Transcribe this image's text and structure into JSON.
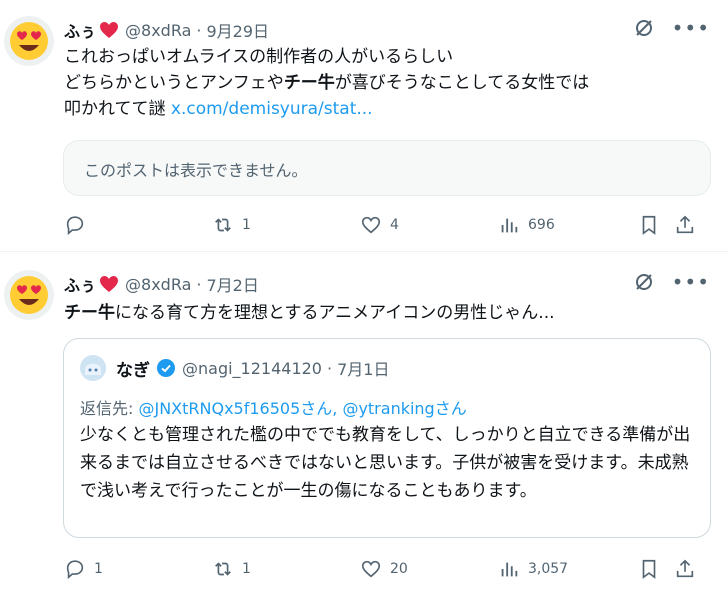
{
  "tweets": [
    {
      "name": "ふぅ",
      "handle": "@8xdRa",
      "separator": "·",
      "date": "9月29日",
      "lines": [
        {
          "text": "これおっぱいオムライスの制作者の人がいるらしい"
        },
        {
          "pre": "どちらかというとアンフェや",
          "bold": "チー牛",
          "post": "が喜びそうなことしてる女性では"
        },
        {
          "pre": "叩かれてて謎 ",
          "link": "x.com/demisyura/stat..."
        }
      ],
      "unavailable": "このポストは表示できません。",
      "actions": {
        "reply": "",
        "retweet": "1",
        "like": "4",
        "views": "696"
      }
    },
    {
      "name": "ふぅ",
      "handle": "@8xdRa",
      "separator": "·",
      "date": "7月2日",
      "line": {
        "bold": "チー牛",
        "post": "になる育て方を理想とするアニメアイコンの男性じゃん..."
      },
      "quote": {
        "name": "なぎ",
        "handle": "@nagi_12144120",
        "separator": "·",
        "date": "7月1日",
        "reply_prefix": "返信先: ",
        "reply_to": "@JNXtRNQx5f16505さん, @ytrankingさん",
        "text": "少なくとも管理された檻の中ででも教育をして、しっかりと自立できる準備が出来るまでは自立させるべきではないと思います。子供が被害を受けます。未成熟で浅い考えで行ったことが一生の傷になることもあります。"
      },
      "actions": {
        "reply": "1",
        "retweet": "1",
        "like": "20",
        "views": "3,057"
      }
    }
  ],
  "icons": {
    "avatar": "heart-eyes-emoji",
    "name_badge": "red-heart",
    "grok": "grok-icon",
    "more": "more-icon",
    "reply": "reply-icon",
    "retweet": "retweet-icon",
    "like": "like-icon",
    "views": "views-icon",
    "bookmark": "bookmark-icon",
    "share": "share-icon",
    "verified": "verified-badge"
  },
  "colors": {
    "text": "#0f1419",
    "secondary": "#536471",
    "link": "#1d9bf0",
    "heart": "#e3284b",
    "emoji": "#ffcc33"
  }
}
